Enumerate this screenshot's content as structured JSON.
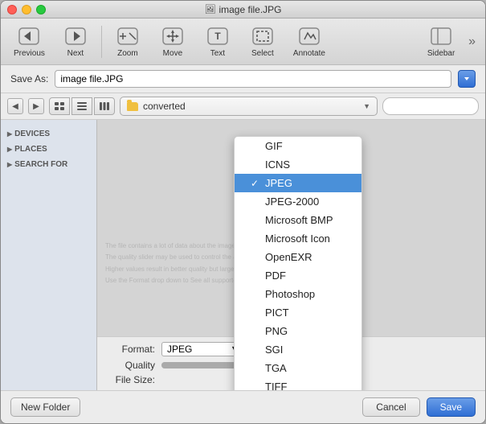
{
  "window": {
    "title": "image file.JPG"
  },
  "toolbar": {
    "previous_label": "Previous",
    "next_label": "Next",
    "zoom_label": "Zoom",
    "move_label": "Move",
    "text_label": "Text",
    "select_label": "Select",
    "annotate_label": "Annotate",
    "sidebar_label": "Sidebar"
  },
  "saveas": {
    "label": "Save As:",
    "filename": "image file.JPG"
  },
  "nav": {
    "folder": "converted",
    "search_placeholder": ""
  },
  "sidebar": {
    "sections": [
      {
        "label": "DEVICES"
      },
      {
        "label": "PLACES"
      },
      {
        "label": "SEARCH FOR"
      }
    ]
  },
  "format": {
    "label": "Format:",
    "value": "JPEG",
    "quality_label": "Quality",
    "filesize_label": "File Size:"
  },
  "dropdown": {
    "items": [
      {
        "label": "GIF",
        "selected": false
      },
      {
        "label": "ICNS",
        "selected": false
      },
      {
        "label": "JPEG",
        "selected": true
      },
      {
        "label": "JPEG-2000",
        "selected": false
      },
      {
        "label": "Microsoft BMP",
        "selected": false
      },
      {
        "label": "Microsoft Icon",
        "selected": false
      },
      {
        "label": "OpenEXR",
        "selected": false
      },
      {
        "label": "PDF",
        "selected": false
      },
      {
        "label": "Photoshop",
        "selected": false
      },
      {
        "label": "PICT",
        "selected": false
      },
      {
        "label": "PNG",
        "selected": false
      },
      {
        "label": "SGI",
        "selected": false
      },
      {
        "label": "TGA",
        "selected": false
      },
      {
        "label": "TIFF",
        "selected": false
      }
    ]
  },
  "actions": {
    "new_folder": "New Folder",
    "cancel": "Cancel",
    "save": "Save"
  }
}
